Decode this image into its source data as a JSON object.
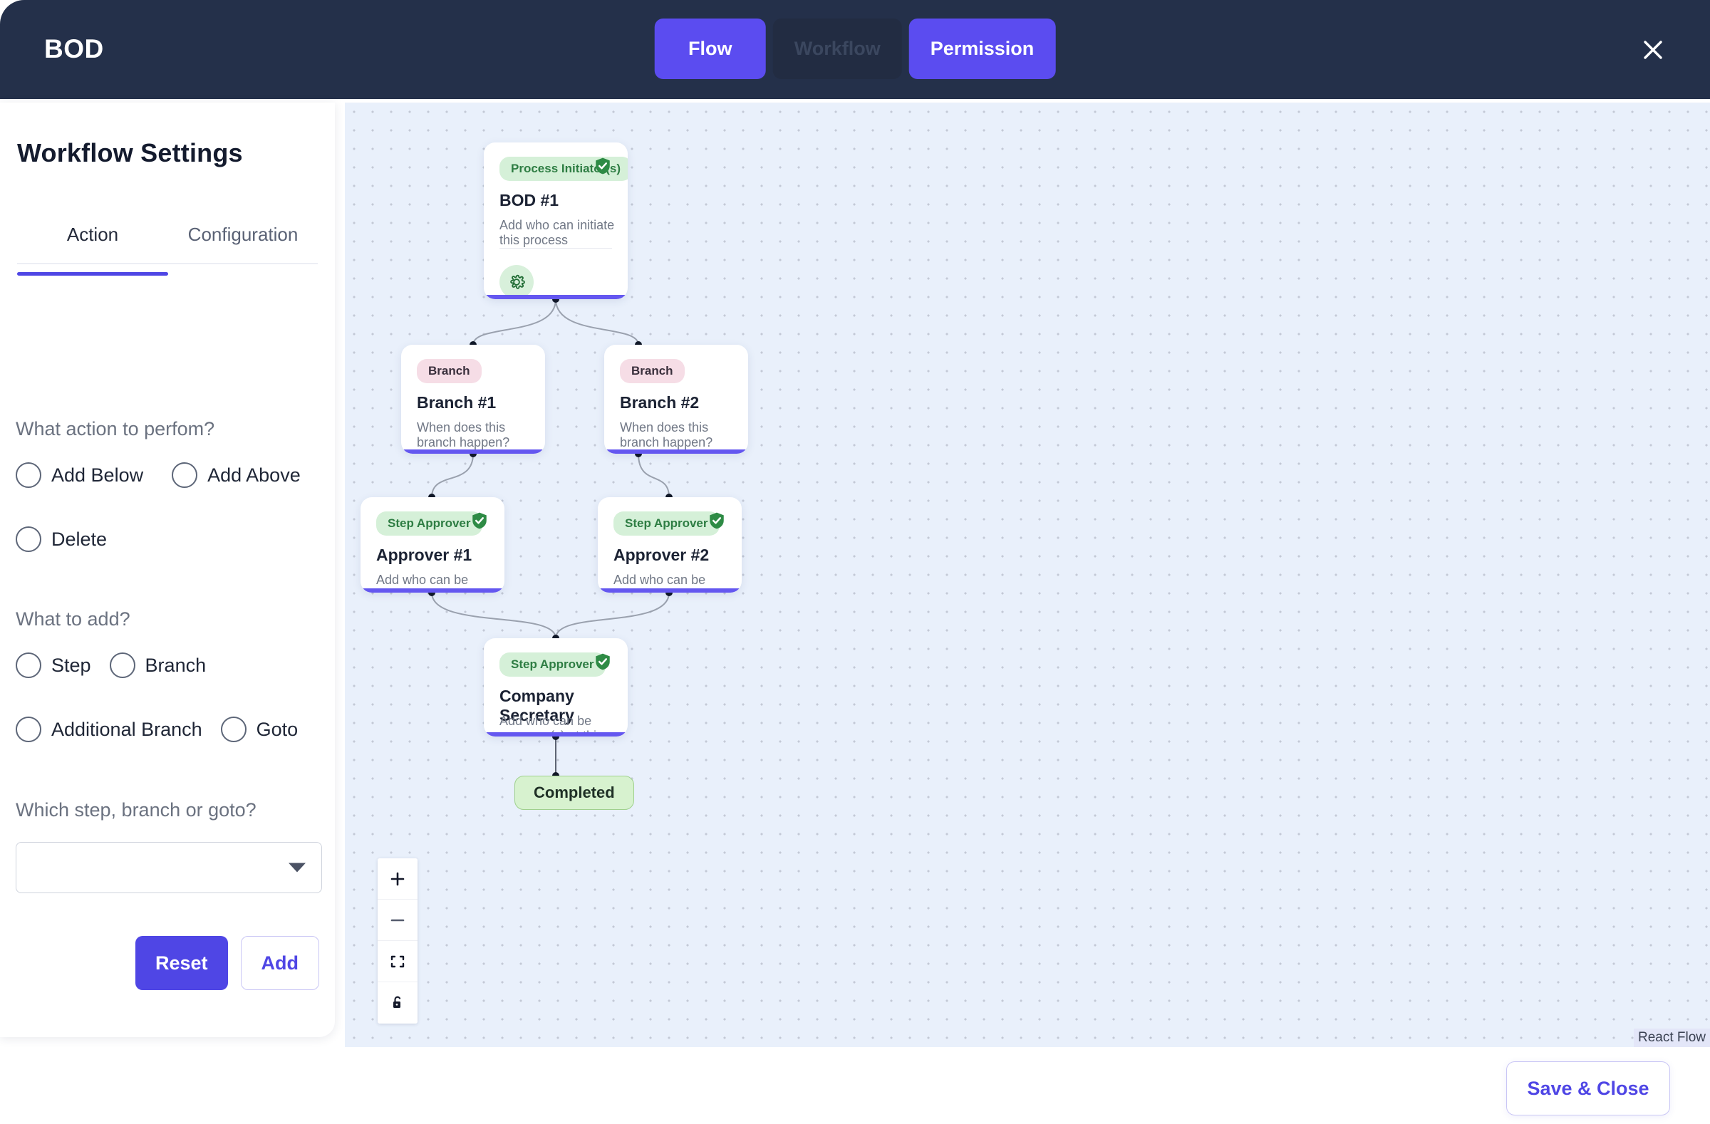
{
  "header": {
    "title": "BOD",
    "tabs": [
      {
        "label": "Flow",
        "state": "active"
      },
      {
        "label": "Workflow",
        "state": "disabled"
      },
      {
        "label": "Permission",
        "state": "active"
      }
    ],
    "close_label": "close-icon"
  },
  "sidebar": {
    "title": "Workflow Settings",
    "tabs": [
      {
        "label": "Action",
        "selected": true
      },
      {
        "label": "Configuration",
        "selected": false
      }
    ],
    "questions": {
      "action": "What action to perfom?",
      "add": "What to add?",
      "which": "Which step, branch or goto?"
    },
    "action_options": [
      "Add Below",
      "Add Above",
      "Delete"
    ],
    "add_options": [
      "Step",
      "Branch",
      "Additional Branch",
      "Goto"
    ],
    "select": {
      "value": "",
      "placeholder": ""
    },
    "buttons": {
      "reset": "Reset",
      "add": "Add"
    }
  },
  "canvas": {
    "nodes": [
      {
        "id": "root",
        "badge": "Process Initiator(s)",
        "title": "BOD #1",
        "subtitle": "Add who can initiate this process",
        "kind": "initiator",
        "has_check": true
      },
      {
        "id": "branch1",
        "badge": "Branch",
        "title": "Branch #1",
        "subtitle": "When does this branch happen?",
        "kind": "branch",
        "has_check": false
      },
      {
        "id": "branch2",
        "badge": "Branch",
        "title": "Branch #2",
        "subtitle": "When does this branch happen?",
        "kind": "branch",
        "has_check": false
      },
      {
        "id": "approver1",
        "badge": "Step Approver",
        "title": "Approver #1",
        "subtitle": "Add who can be approver(s) at this level",
        "kind": "approver",
        "has_check": true
      },
      {
        "id": "approver2",
        "badge": "Step Approver",
        "title": "Approver #2",
        "subtitle": "Add who can be approver(s) at this level",
        "kind": "approver",
        "has_check": true
      },
      {
        "id": "secretary",
        "badge": "Step Approver",
        "title": "Company Secretary",
        "subtitle": "Add who can be approver(s) at this level",
        "kind": "approver",
        "has_check": true
      }
    ],
    "terminal_label": "Completed",
    "attribution": "React Flow",
    "zoom_controls": [
      "zoom-in-icon",
      "zoom-out-icon",
      "fit-view-icon",
      "unlock-icon"
    ]
  },
  "footer": {
    "save_close": "Save & Close"
  },
  "colors": {
    "accent": "#4f46e5",
    "topbar": "#24304a",
    "node_bar": "#6457f0",
    "badge_green_bg": "#d5f0d8",
    "badge_green_fg": "#2e7d43",
    "badge_pink_bg": "#f6dde6",
    "canvas_bg": "#e9f0fb",
    "completed_bg": "#d7f2cf"
  }
}
